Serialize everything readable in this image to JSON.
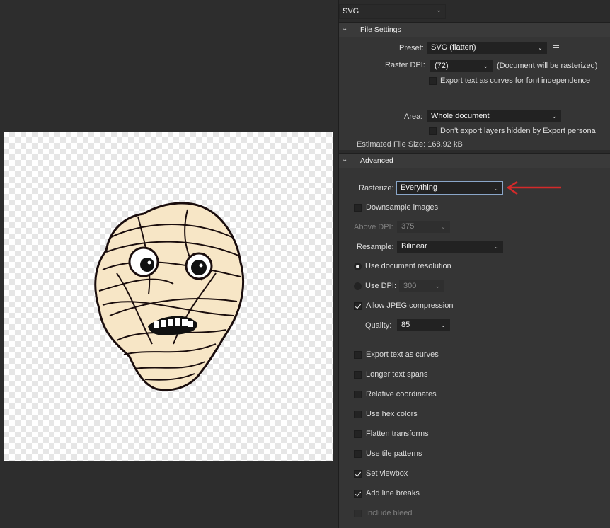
{
  "format": {
    "value": "SVG"
  },
  "file_settings": {
    "title": "File Settings",
    "preset_label": "Preset:",
    "preset_value": "SVG (flatten)",
    "raster_dpi_label": "Raster DPI:",
    "raster_dpi_value": "(72)",
    "raster_note": "(Document will be rasterized)",
    "export_text_curves_font": "Export text as curves for font independence",
    "area_label": "Area:",
    "area_value": "Whole document",
    "dont_export_hidden": "Don't export layers hidden by Export persona",
    "file_size": "Estimated File Size: 168.92 kB"
  },
  "advanced": {
    "title": "Advanced",
    "rasterize_label": "Rasterize:",
    "rasterize_value": "Everything",
    "downsample": "Downsample images",
    "above_dpi_label": "Above DPI:",
    "above_dpi_value": "375",
    "resample_label": "Resample:",
    "resample_value": "Bilinear",
    "use_doc_res": "Use document resolution",
    "use_dpi": "Use DPI:",
    "use_dpi_value": "300",
    "allow_jpeg": "Allow JPEG compression",
    "quality_label": "Quality:",
    "quality_value": "85",
    "options": [
      {
        "label": "Export text as curves",
        "checked": false,
        "enabled": true
      },
      {
        "label": "Longer text spans",
        "checked": false,
        "enabled": true
      },
      {
        "label": "Relative coordinates",
        "checked": false,
        "enabled": true
      },
      {
        "label": "Use hex colors",
        "checked": false,
        "enabled": true
      },
      {
        "label": "Flatten transforms",
        "checked": false,
        "enabled": true
      },
      {
        "label": "Use tile patterns",
        "checked": false,
        "enabled": true
      },
      {
        "label": "Set viewbox",
        "checked": true,
        "enabled": true
      },
      {
        "label": "Add line breaks",
        "checked": true,
        "enabled": true
      },
      {
        "label": "Include bleed",
        "checked": false,
        "enabled": false
      }
    ]
  },
  "colors": {
    "annotation_arrow": "#d42a2a",
    "focus_border": "#8aa6c8"
  }
}
